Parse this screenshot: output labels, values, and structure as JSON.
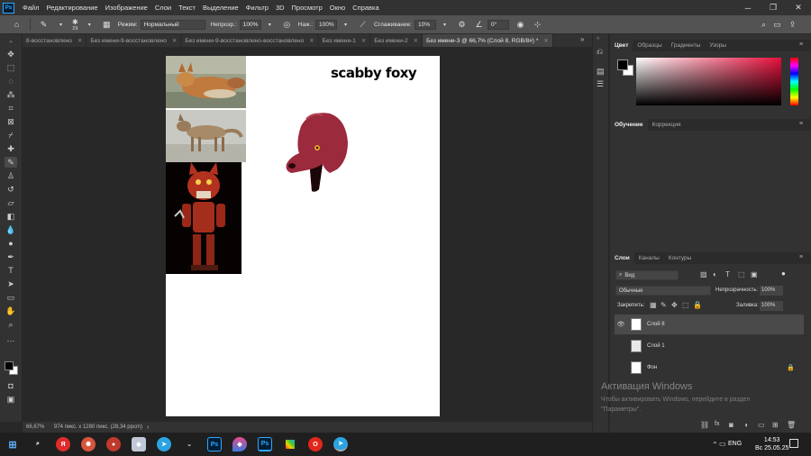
{
  "menu": {
    "items": [
      "Файл",
      "Редактирование",
      "Изображение",
      "Слои",
      "Текст",
      "Выделение",
      "Фильтр",
      "3D",
      "Просмотр",
      "Окно",
      "Справка"
    ]
  },
  "options": {
    "brush_size": "29",
    "mode_label": "Режим:",
    "mode_value": "Нормальный",
    "opacity_label": "Непрозр.:",
    "opacity_value": "100%",
    "pressure_label": "Наж.:",
    "pressure_value": "100%",
    "smoothing_label": "Сглаживание:",
    "smoothing_value": "10%",
    "angle_value": "0°"
  },
  "tabs": [
    {
      "label": "8-восстановлено",
      "active": false
    },
    {
      "label": "Без имени-9-восстановлено",
      "active": false
    },
    {
      "label": "Без имени-9-восстановлено-восстановлено",
      "active": false
    },
    {
      "label": "Без имени-1",
      "active": false
    },
    {
      "label": "Без имени-2",
      "active": false
    },
    {
      "label": "Без имени-3 @ 66,7% (Слой 8, RGB/8#) *",
      "active": true
    }
  ],
  "canvas": {
    "title_text": "scabby foxy"
  },
  "status": {
    "zoom": "66,67%",
    "doc_size": "974 пикс. x 1280 пикс. (28,34 ppcm)"
  },
  "panels": {
    "color_tabs": [
      "Цвет",
      "Образцы",
      "Градиенты",
      "Узоры"
    ],
    "learn_tabs": [
      "Обучение",
      "Коррекция"
    ],
    "layers_tabs": [
      "Слои",
      "Каналы",
      "Контуры"
    ],
    "kind_label": "Вид",
    "blend_mode": "Обычные",
    "opacity_label": "Непрозрачность:",
    "opacity_value": "100%",
    "lock_label": "Закрепить:",
    "fill_label": "Заливка:",
    "fill_value": "100%",
    "layers": [
      {
        "name": "Слой 8",
        "visible": true,
        "selected": true
      },
      {
        "name": "Слой 1",
        "visible": false,
        "selected": false
      },
      {
        "name": "Фон",
        "visible": false,
        "selected": false
      }
    ]
  },
  "watermark": {
    "title": "Активация Windows",
    "line1": "Чтобы активировать Windows, перейдите в раздел",
    "line2": "\"Параметры\"."
  },
  "taskbar": {
    "lang": "ENG",
    "time": "14:53",
    "date": "Вс 25.05.25"
  },
  "colors": {
    "accent": "#31a8ff",
    "foxy_red": "#9b2a3c"
  }
}
